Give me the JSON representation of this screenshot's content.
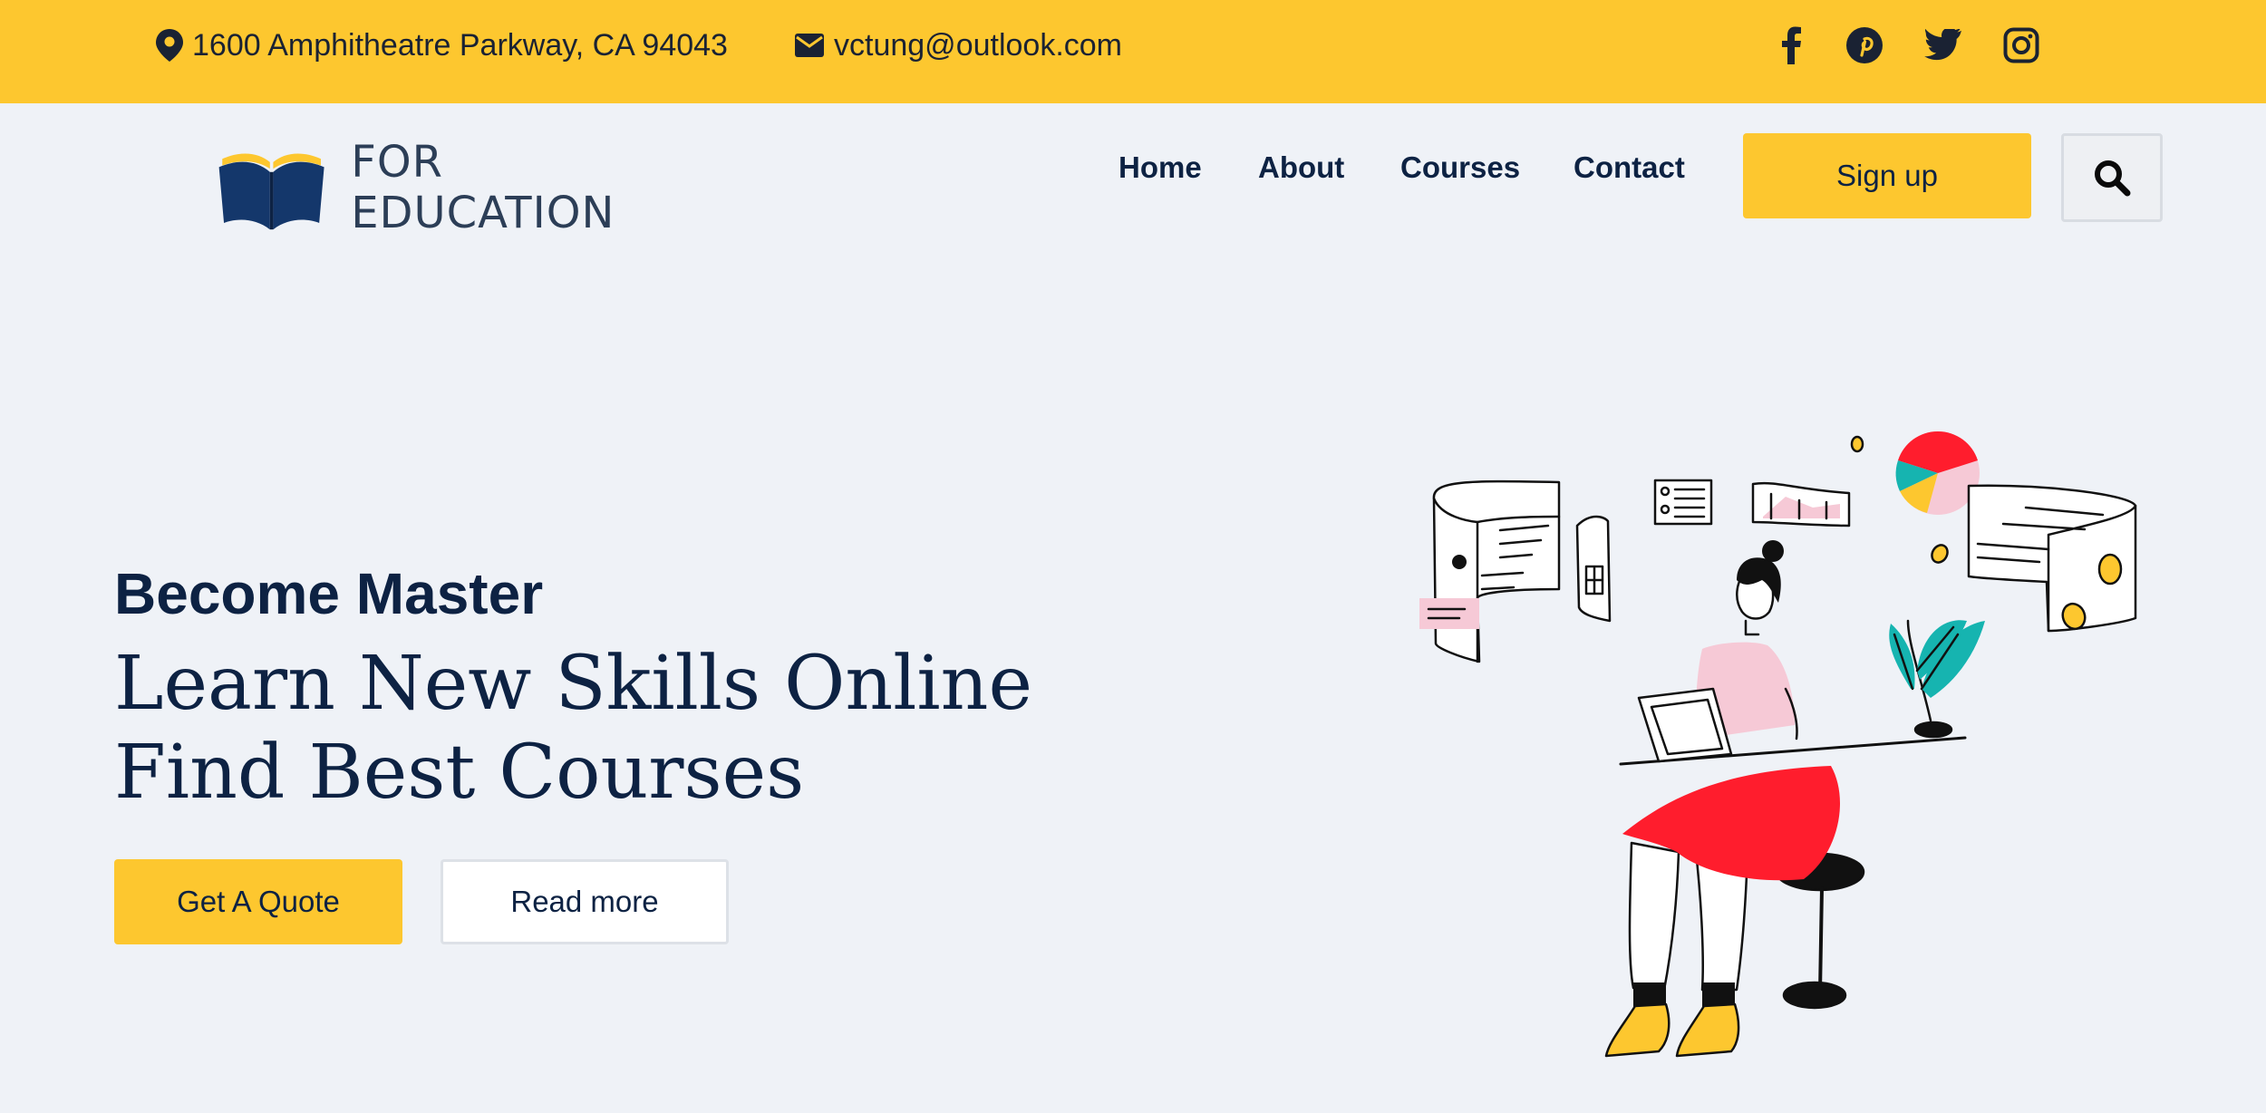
{
  "topbar": {
    "address": "1600 Amphitheatre Parkway, CA 94043",
    "email": "vctung@outlook.com",
    "social": [
      "facebook-icon",
      "pinterest-icon",
      "twitter-icon",
      "instagram-icon"
    ],
    "background": "#fdc72f"
  },
  "header": {
    "logo_text": "FOR EDUCATION",
    "nav": [
      "Home",
      "About",
      "Courses",
      "Contact"
    ],
    "signup_label": "Sign up",
    "search_icon": "search-icon"
  },
  "hero": {
    "subtitle": "Become Master",
    "title": "Learn New Skills Online Find Best Courses",
    "quote_button": "Get A Quote",
    "read_more_button": "Read more"
  },
  "colors": {
    "accent": "#fdc72f",
    "text": "#0d2243",
    "background": "#eff2f7"
  }
}
